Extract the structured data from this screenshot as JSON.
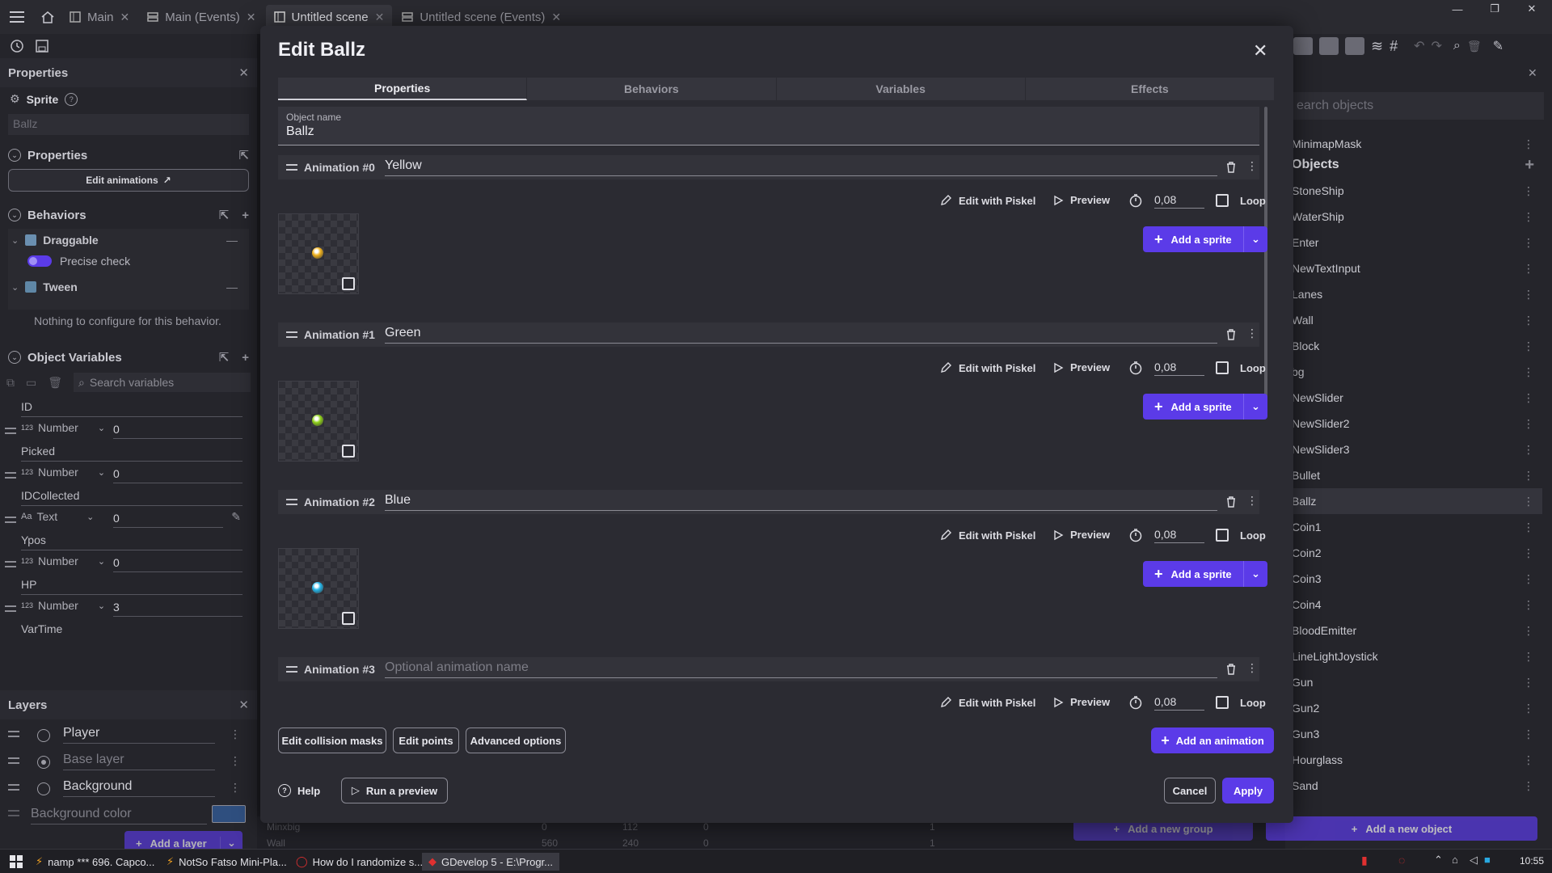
{
  "topbar": {
    "tabs": [
      {
        "label": "Main"
      },
      {
        "label": "Main (Events)"
      },
      {
        "label": "Untitled scene"
      },
      {
        "label": "Untitled scene (Events)"
      }
    ]
  },
  "left": {
    "properties_title": "Properties",
    "object_type": "Sprite",
    "object_name_value": "Ballz",
    "properties_section": "Properties",
    "edit_animations": "Edit animations",
    "behaviors_section": "Behaviors",
    "behaviors": [
      {
        "name": "Draggable",
        "option": "Precise check"
      },
      {
        "name": "Tween",
        "note": "Nothing to configure for this behavior."
      }
    ],
    "variables_section": "Object Variables",
    "search_variables_placeholder": "Search variables",
    "variables": [
      {
        "name": "ID",
        "type": "Number",
        "value": "0"
      },
      {
        "name": "Picked",
        "type": "Number",
        "value": "0"
      },
      {
        "name": "IDCollected",
        "type": "Text",
        "value": "0"
      },
      {
        "name": "Ypos",
        "type": "Number",
        "value": "0"
      },
      {
        "name": "HP",
        "type": "Number",
        "value": "3"
      },
      {
        "name": "VarTime",
        "type": "",
        "value": ""
      }
    ],
    "layers_title": "Layers",
    "layers": [
      {
        "name": "Player"
      },
      {
        "name": "Base layer"
      },
      {
        "name": "Background"
      }
    ],
    "background_color": "Background color",
    "background_color_value": "#2f4f7f",
    "add_layer": "Add a layer"
  },
  "dialog": {
    "title": "Edit Ballz",
    "tabs": [
      "Properties",
      "Behaviors",
      "Variables",
      "Effects"
    ],
    "object_name_label": "Object name",
    "object_name_value": "Ballz",
    "animations": [
      {
        "label": "Animation #0",
        "name": "Yellow",
        "speed": "0,08",
        "ball_color": "#f0b21e"
      },
      {
        "label": "Animation #1",
        "name": "Green",
        "speed": "0,08",
        "ball_color": "#8fd11a"
      },
      {
        "label": "Animation #2",
        "name": "Blue",
        "speed": "0,08",
        "ball_color": "#25b5e8"
      },
      {
        "label": "Animation #3",
        "name": "",
        "placeholder": "Optional animation name",
        "speed": "0,08"
      }
    ],
    "edit_with_piskel": "Edit with Piskel",
    "preview": "Preview",
    "loop": "Loop",
    "add_sprite": "Add a sprite",
    "edit_collision_masks": "Edit collision masks",
    "edit_points": "Edit points",
    "advanced_options": "Advanced options",
    "add_animation": "Add an animation",
    "help": "Help",
    "run_preview": "Run a preview",
    "cancel": "Cancel",
    "apply": "Apply"
  },
  "right": {
    "search_placeholder": "earch objects",
    "minimap": "MinimapMask",
    "objects_header": "Objects",
    "objects": [
      "StoneShip",
      "WaterShip",
      "Enter",
      "NewTextInput",
      "Lanes",
      "Wall",
      "Block",
      "bg",
      "NewSlider",
      "NewSlider2",
      "NewSlider3",
      "Bullet",
      "Ballz",
      "Coin1",
      "Coin2",
      "Coin3",
      "Coin4",
      "BloodEmitter",
      "LineLightJoystick",
      "Gun",
      "Gun2",
      "Gun3",
      "Hourglass",
      "Sand"
    ],
    "selected": "Ballz",
    "add_group": "Add a new group",
    "add_object": "Add a new object"
  },
  "background_rows": [
    {
      "name": "Minxbig",
      "x": "0",
      "y": "112",
      "z": "0",
      "layer": "1"
    },
    {
      "name": "Wall",
      "x": "560",
      "y": "240",
      "z": "0",
      "layer": "1"
    }
  ],
  "taskbar": {
    "items": [
      "namp *** 696. Capco...",
      "NotSo Fatso Mini-Pla...",
      "How do I randomize s...",
      "GDevelop 5 - E:\\Progr..."
    ],
    "time": "10:55"
  },
  "colors": {
    "accent": "#5b3be8",
    "panel": "#25252b",
    "dialog": "#2b2b32"
  }
}
